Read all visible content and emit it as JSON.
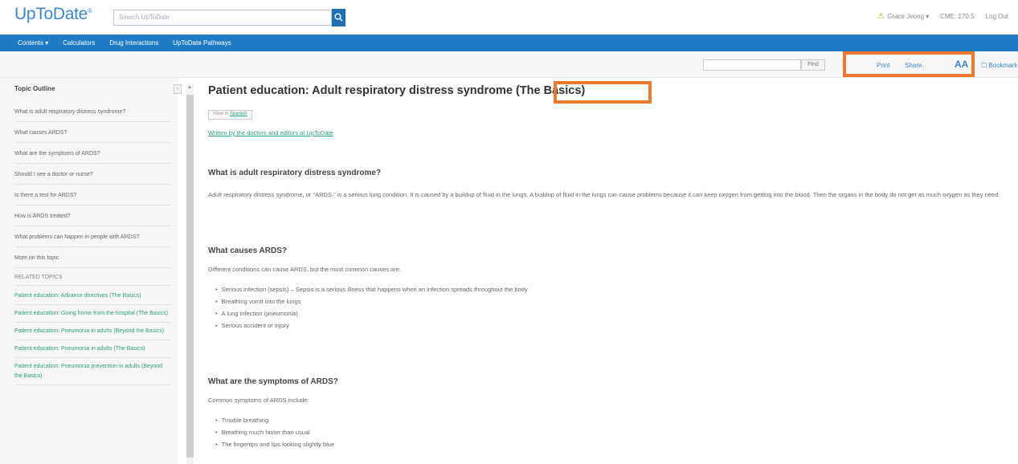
{
  "header": {
    "logo": "UpToDate",
    "logo_mark": "®",
    "search_placeholder": "Search UpToDate",
    "user_name": "Grace Jeong",
    "cme": "CME: 170.5",
    "logout": "Log Out"
  },
  "nav": {
    "items": [
      "Contents",
      "Calculators",
      "Drug Interactions",
      "UpToDate Pathways"
    ]
  },
  "toolbar": {
    "find_label": "Find",
    "print": "Print",
    "share": "Share",
    "font_size": "AA",
    "bookmark": "Bookmark"
  },
  "sidebar": {
    "title": "Topic Outline",
    "collapse": "‹",
    "items": [
      "What is adult respiratory distress syndrome?",
      "What causes ARDS?",
      "What are the symptoms of ARDS?",
      "Should I see a doctor or nurse?",
      "Is there a test for ARDS?",
      "How is ARDS treated?",
      "What problems can happen in people with ARDS?",
      "More on this topic"
    ],
    "related_heading": "RELATED TOPICS",
    "related": [
      "Patient education: Advance directives (The Basics)",
      "Patient education: Going home from the hospital (The Basics)",
      "Patient education: Pneumonia in adults (Beyond the Basics)",
      "Patient education: Pneumonia in adults (The Basics)",
      "Patient education: Pneumonia prevention in adults (Beyond the Basics)"
    ]
  },
  "main": {
    "title": "Patient education: Adult respiratory distress syndrome (The Basics)",
    "lang_prefix": "View in",
    "lang_link": "Spanish",
    "byline": "Written by the doctors and editors at UpToDate",
    "sections": [
      {
        "heading": "What is adult respiratory distress syndrome?",
        "body": "Adult respiratory distress syndrome, or \"ARDS,\" is a serious lung condition. It is caused by a buildup of fluid in the lungs. A buildup of fluid in the lungs can cause problems because it can keep oxygen from getting into the blood. Then the organs in the body do not get as much oxygen as they need."
      },
      {
        "heading": "What causes ARDS?",
        "body": "Different conditions can cause ARDS, but the most common causes are:",
        "bullets": [
          "Serious infection (sepsis) – Sepsis is a serious illness that happens when an infection spreads throughout the body",
          "Breathing vomit into the lungs",
          "A lung infection (pneumonia)",
          "Serious accident or injury"
        ]
      },
      {
        "heading": "What are the symptoms of ARDS?",
        "body": "Common symptoms of ARDS include:",
        "bullets": [
          "Trouble breathing",
          "Breathing much faster than usual",
          "The fingertips and lips looking slightly blue"
        ]
      }
    ]
  },
  "colors": {
    "brand_blue": "#1f7bc4",
    "link_green": "#2aa36e",
    "highlight_orange": "#ee7a2e"
  }
}
